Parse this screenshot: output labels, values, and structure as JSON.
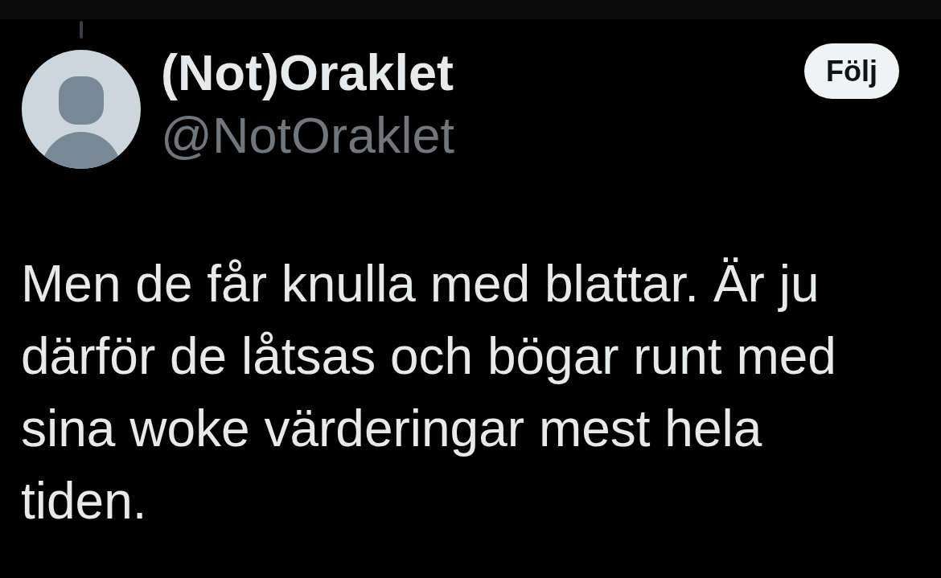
{
  "tweet": {
    "author": {
      "display_name": "(Not)Oraklet",
      "handle": "@NotOraklet"
    },
    "follow_button": {
      "label": "Följ"
    },
    "text": "Men de får knulla med blattar. Är ju därför de låtsas och bögar runt med sina woke värderingar mest hela tiden."
  }
}
